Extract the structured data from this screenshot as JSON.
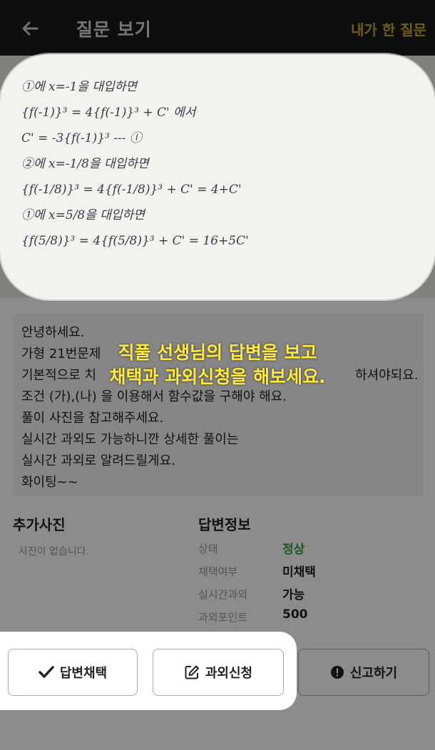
{
  "header": {
    "title": "질문 보기",
    "right_link": "내가 한 질문"
  },
  "photo": {
    "lines": [
      "①에 x=-1을 대입하면",
      "{f(-1)}³ = 4{f(-1)}³ + C' 에서",
      "C' = -3{f(-1)}³          --- ⓛ",
      "②에 x=-1/8을 대입하면",
      "{f(-1/8)}³ = 4{f(-1/8)}³ + C' = 4+C'",
      "①에 x=5/8을 대입하면",
      "{f(5/8)}³ = 4{f(5/8)}³ + C' = 16+5C'"
    ]
  },
  "message": {
    "lines": [
      "안녕하세요.",
      "가형 21번문제",
      "기본적으로 치",
      "조건 (가),(나) 을 이용해서 함수값을 구해야 해요.",
      "풀이 사진을 참고해주세요.",
      "실시간 과외도 가능하니깐 상세한 풀이는",
      "실시간 과외로 알려드릴게요.",
      "화이팅~~"
    ],
    "partial_tail": "하셔야되요."
  },
  "tutorial": {
    "line1": "직풀 선생님의 답변을 보고",
    "line2": "채택과 과외신청을 해보세요."
  },
  "extra_photos": {
    "title": "추가사진",
    "empty_text": "사진이 없습니다."
  },
  "answer_info": {
    "title": "답변정보",
    "rows": [
      {
        "label": "상태",
        "value": "정상"
      },
      {
        "label": "채택여부",
        "value": "미채택"
      },
      {
        "label": "실시간과외",
        "value": "가능"
      },
      {
        "label": "과외포인트",
        "value": "500"
      }
    ]
  },
  "buttons": {
    "adopt": "답변채택",
    "tutor": "과외신청",
    "report": "신고하기"
  },
  "colors": {
    "accent": "#ffe93b",
    "status_ok": "#2e9a3f",
    "header_bg": "#1a1a1a"
  }
}
